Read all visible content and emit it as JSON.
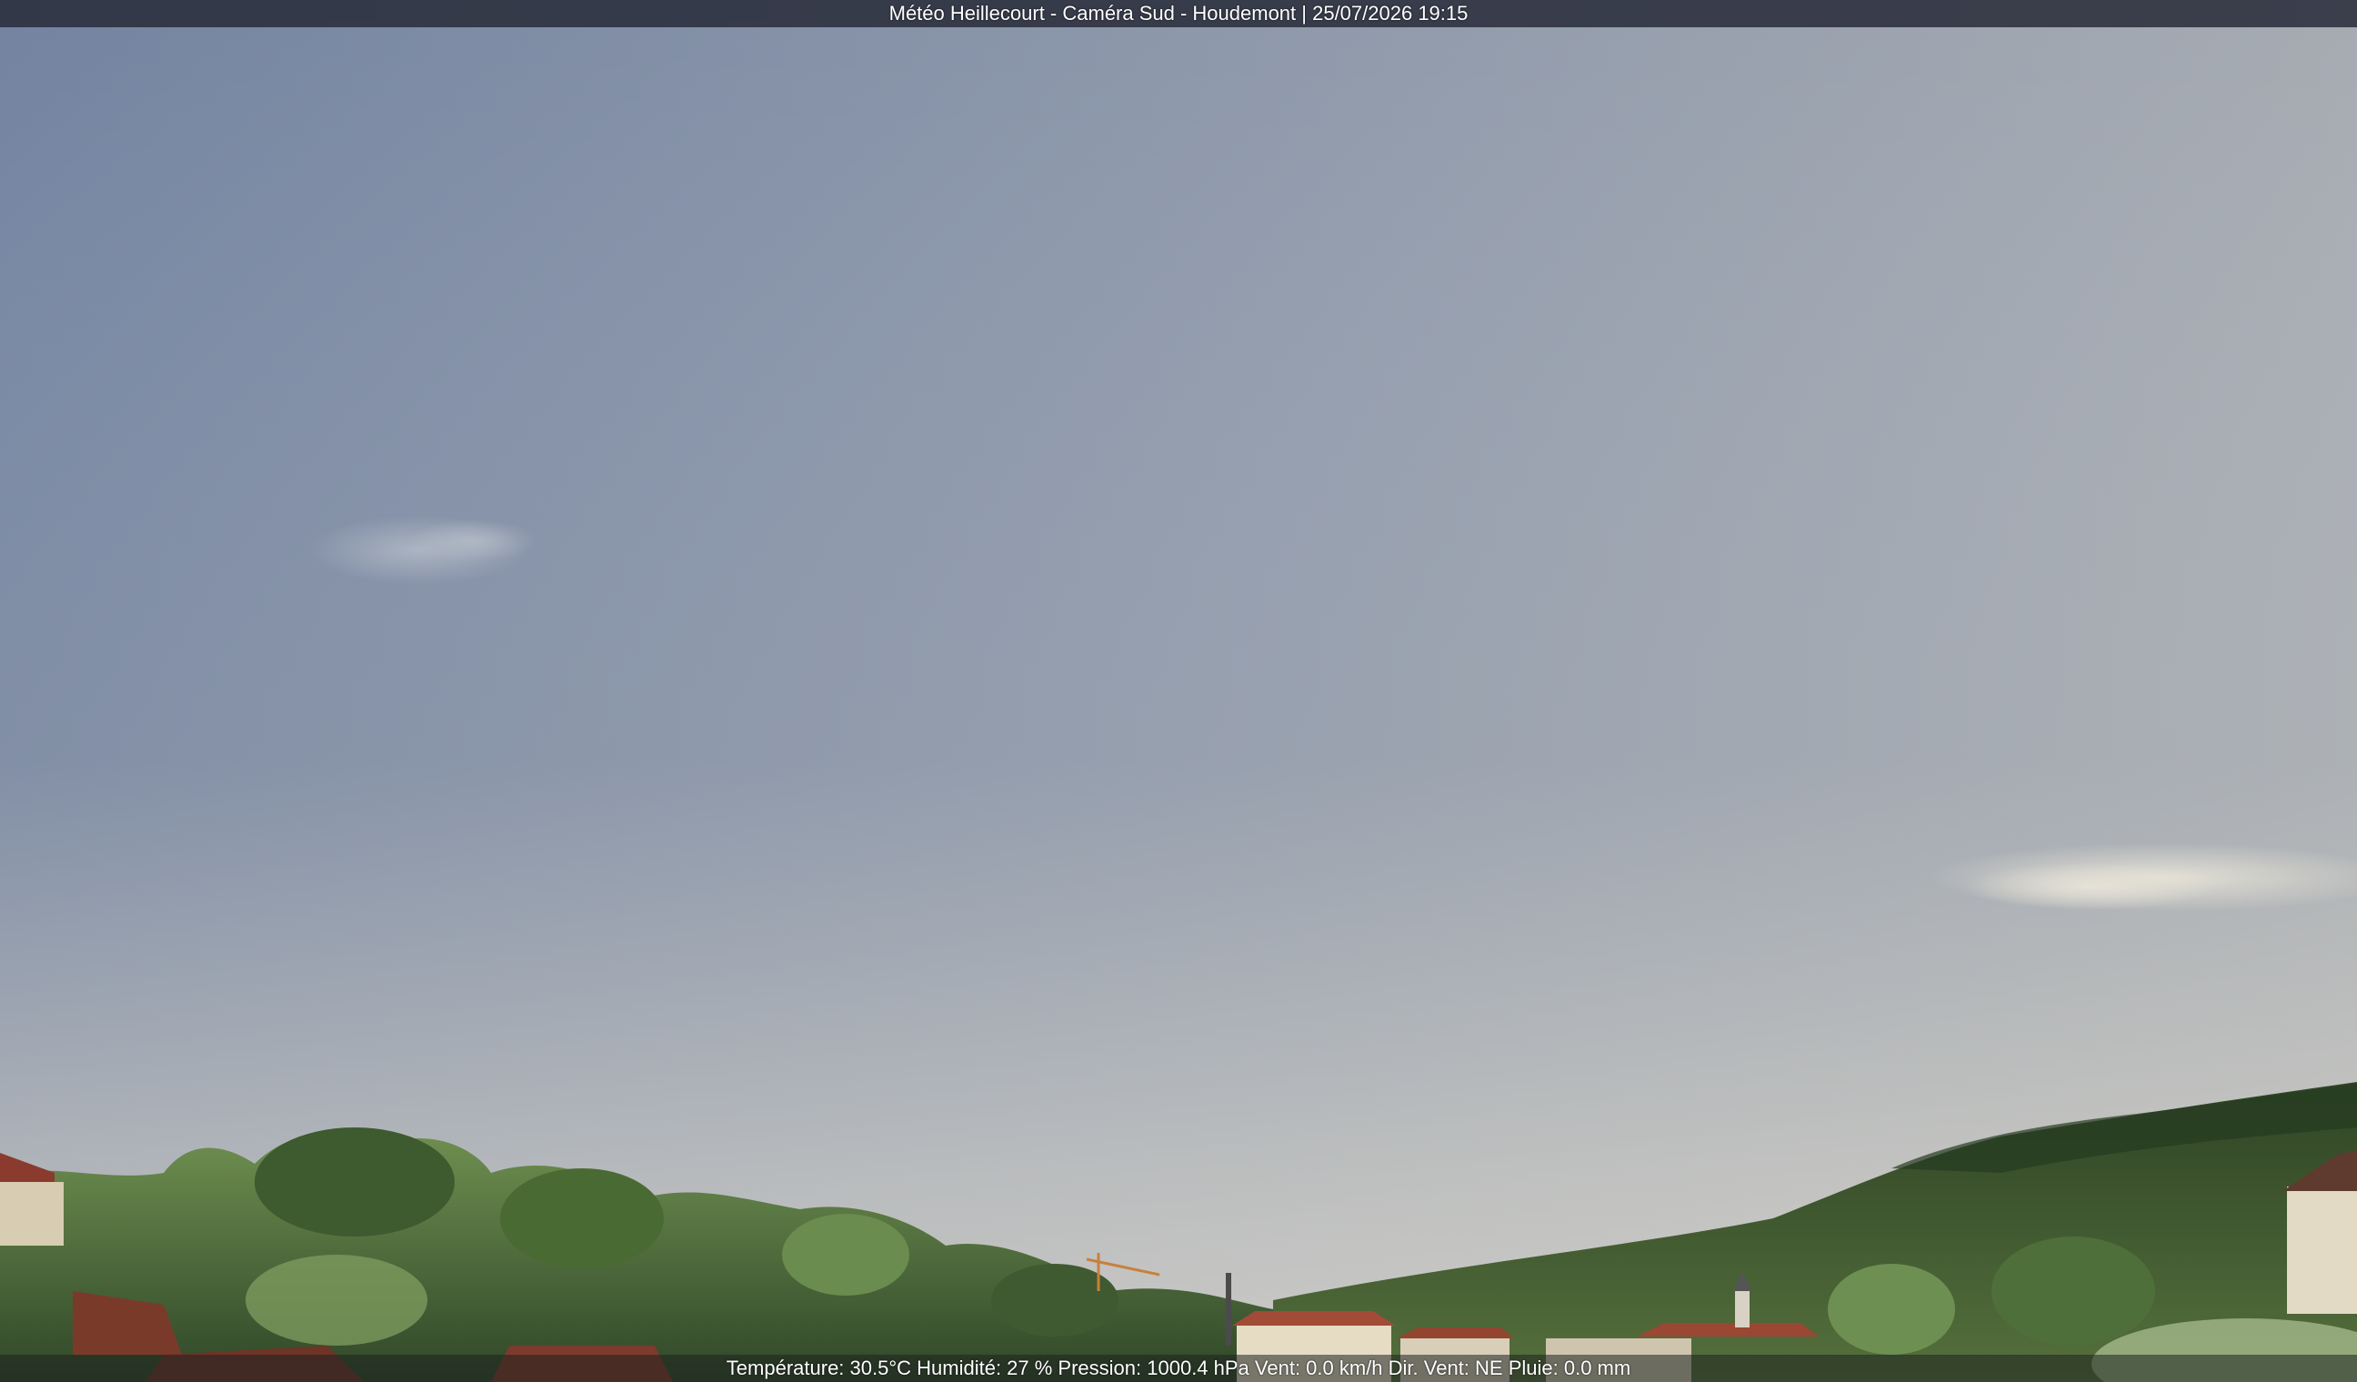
{
  "header": {
    "caption": "Météo Heillecourt - Caméra Sud - Houdemont | 25/07/2026 19:15"
  },
  "footer": {
    "readout": "Température: 30.5°C  Humidité: 27 % Pression: 1000.4 hPa Vent: 0.0 km/h Dir. Vent: NE Pluie: 0.0 mm"
  },
  "colors": {
    "sky_top_left": "#7383a0",
    "sky_top_right": "#a3a9b3",
    "sky_horizon": "#c8c9c2",
    "foliage_dark": "#2f4a24",
    "foliage_light": "#6f8f4e",
    "roof_red": "#8a3b2e",
    "building_cream": "#e6dcc4"
  }
}
